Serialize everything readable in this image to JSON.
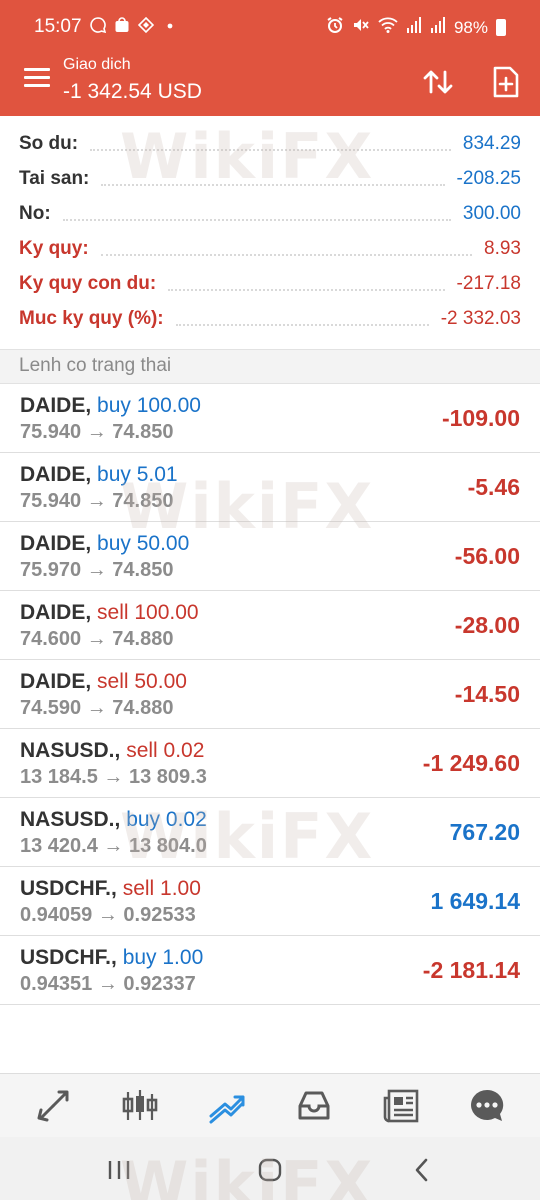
{
  "status_bar": {
    "time": "15:07",
    "battery": "98%"
  },
  "header": {
    "title": "Giao dich",
    "balance": "-1 342.54 USD"
  },
  "summary": [
    {
      "label": "So du:",
      "value": "834.29",
      "style": "normal"
    },
    {
      "label": "Tai san:",
      "value": "-208.25",
      "style": "normal"
    },
    {
      "label": "No:",
      "value": "300.00",
      "style": "normal"
    },
    {
      "label": "Ky quy:",
      "value": "8.93",
      "style": "red"
    },
    {
      "label": "Ky quy con du:",
      "value": "-217.18",
      "style": "red"
    },
    {
      "label": "Muc ky quy (%):",
      "value": "-2 332.03",
      "style": "red"
    }
  ],
  "section_title": "Lenh co trang thai",
  "orders": [
    {
      "symbol": "DAIDE,",
      "side": "buy 100.00",
      "side_type": "buy",
      "prices": "75.940 → 74.850",
      "profit": "-109.00",
      "profit_sign": "neg"
    },
    {
      "symbol": "DAIDE,",
      "side": "buy 5.01",
      "side_type": "buy",
      "prices": "75.940 → 74.850",
      "profit": "-5.46",
      "profit_sign": "neg"
    },
    {
      "symbol": "DAIDE,",
      "side": "buy 50.00",
      "side_type": "buy",
      "prices": "75.970 → 74.850",
      "profit": "-56.00",
      "profit_sign": "neg"
    },
    {
      "symbol": "DAIDE,",
      "side": "sell 100.00",
      "side_type": "sell",
      "prices": "74.600 → 74.880",
      "profit": "-28.00",
      "profit_sign": "neg"
    },
    {
      "symbol": "DAIDE,",
      "side": "sell 50.00",
      "side_type": "sell",
      "prices": "74.590 → 74.880",
      "profit": "-14.50",
      "profit_sign": "neg"
    },
    {
      "symbol": "NASUSD.,",
      "side": "sell 0.02",
      "side_type": "sell",
      "prices": "13 184.5 → 13 809.3",
      "profit": "-1 249.60",
      "profit_sign": "neg"
    },
    {
      "symbol": "NASUSD.,",
      "side": "buy 0.02",
      "side_type": "buy",
      "prices": "13 420.4 → 13 804.0",
      "profit": "767.20",
      "profit_sign": "pos"
    },
    {
      "symbol": "USDCHF.,",
      "side": "sell 1.00",
      "side_type": "sell",
      "prices": "0.94059 → 0.92533",
      "profit": "1 649.14",
      "profit_sign": "pos"
    },
    {
      "symbol": "USDCHF.,",
      "side": "buy 1.00",
      "side_type": "buy",
      "prices": "0.94351 → 0.92337",
      "profit": "-2 181.14",
      "profit_sign": "neg"
    }
  ],
  "tabs": [
    {
      "name": "quotes-icon"
    },
    {
      "name": "chart-icon"
    },
    {
      "name": "trade-icon",
      "active": true
    },
    {
      "name": "history-icon"
    },
    {
      "name": "news-icon"
    },
    {
      "name": "messages-icon"
    }
  ],
  "watermark": "WikiFX",
  "colors": {
    "header": "#e0543f",
    "positive": "#1a73c9",
    "negative": "#c8372d",
    "active_tab": "#2b8fe0",
    "icon": "#5a5a5a"
  }
}
